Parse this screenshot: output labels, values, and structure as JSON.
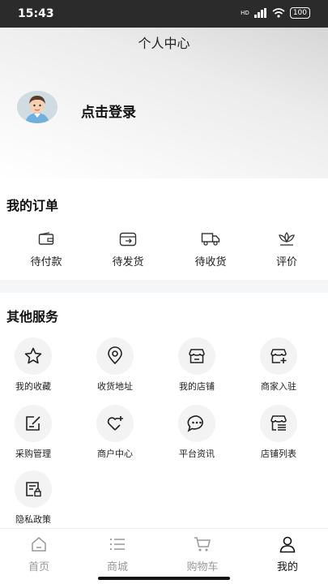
{
  "status_bar": {
    "time": "15:43",
    "battery": "100",
    "network": "HD"
  },
  "header": {
    "title": "个人中心",
    "login": "点击登录"
  },
  "orders": {
    "title": "我的订单",
    "items": [
      {
        "label": "待付款",
        "icon": "wallet-icon"
      },
      {
        "label": "待发货",
        "icon": "ship-box-icon"
      },
      {
        "label": "待收货",
        "icon": "truck-icon"
      },
      {
        "label": "评价",
        "icon": "lotus-icon"
      }
    ]
  },
  "services": {
    "title": "其他服务",
    "items": [
      {
        "label": "我的收藏",
        "icon": "star-icon"
      },
      {
        "label": "收货地址",
        "icon": "location-pin-icon"
      },
      {
        "label": "我的店铺",
        "icon": "store-icon"
      },
      {
        "label": "商家入驻",
        "icon": "store-add-icon"
      },
      {
        "label": "采购管理",
        "icon": "edit-doc-icon"
      },
      {
        "label": "商户中心",
        "icon": "heart-plus-icon"
      },
      {
        "label": "平台资讯",
        "icon": "chat-bubble-icon"
      },
      {
        "label": "店铺列表",
        "icon": "store-list-icon"
      },
      {
        "label": "隐私政策",
        "icon": "privacy-doc-icon"
      }
    ]
  },
  "tabbar": {
    "items": [
      {
        "label": "首页",
        "icon": "home-icon"
      },
      {
        "label": "商城",
        "icon": "list-icon"
      },
      {
        "label": "购物车",
        "icon": "cart-icon"
      },
      {
        "label": "我的",
        "icon": "user-icon"
      }
    ],
    "active": "我的"
  }
}
